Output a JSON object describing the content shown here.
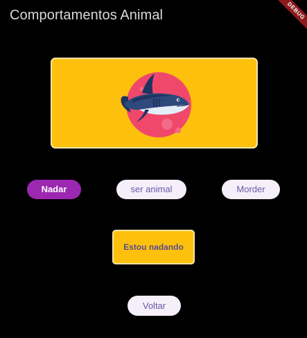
{
  "app_bar": {
    "title": "Comportamentos Animal",
    "debug_banner": "DEBUG"
  },
  "image_card": {
    "icon": "shark-icon",
    "background_color": "#fdc10d",
    "circle_color": "#f0486b"
  },
  "actions": [
    {
      "label": "Nadar",
      "state": "selected",
      "color": "#9c27b0"
    },
    {
      "label": "ser animal",
      "state": "unselected"
    },
    {
      "label": "Morder",
      "state": "unselected"
    }
  ],
  "status": {
    "text": "Estou nadando"
  },
  "back_button": {
    "label": "Voltar"
  }
}
